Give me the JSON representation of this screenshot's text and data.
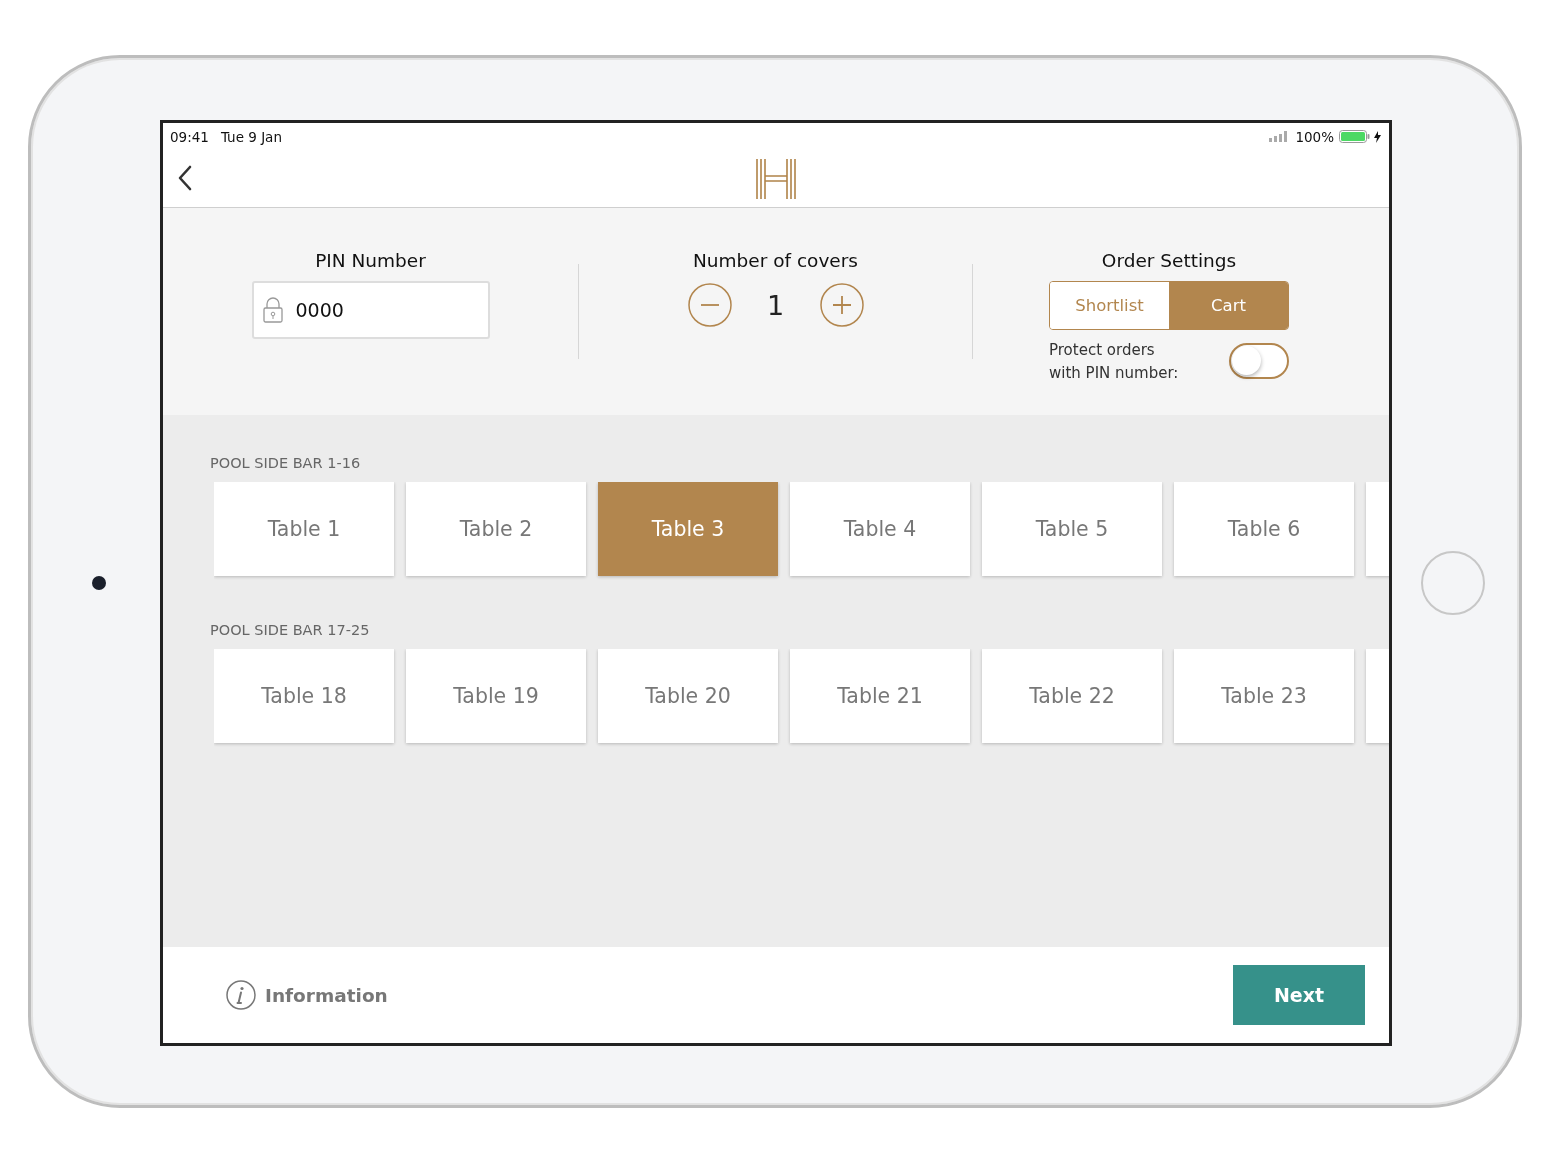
{
  "status_bar": {
    "time": "09:41",
    "date": "Tue 9 Jan",
    "battery": "100%"
  },
  "settings": {
    "pin": {
      "label": "PIN Number",
      "value": "0000"
    },
    "covers": {
      "label": "Number of covers",
      "value": "1"
    },
    "order": {
      "label": "Order Settings",
      "modes": [
        {
          "label": "Shortlist",
          "selected": false
        },
        {
          "label": "Cart",
          "selected": true
        }
      ],
      "protect": {
        "label": "Protect orders with PIN number:",
        "on": false
      }
    }
  },
  "sections": [
    {
      "title": "POOL SIDE BAR 1-16",
      "continues": true,
      "tables": [
        {
          "label": "Table 1",
          "selected": false
        },
        {
          "label": "Table 2",
          "selected": false
        },
        {
          "label": "Table 3",
          "selected": true
        },
        {
          "label": "Table 4",
          "selected": false
        },
        {
          "label": "Table 5",
          "selected": false
        },
        {
          "label": "Table 6",
          "selected": false
        }
      ]
    },
    {
      "title": "POOL SIDE BAR 17-25",
      "continues": true,
      "tables": [
        {
          "label": "Table 18",
          "selected": false
        },
        {
          "label": "Table 19",
          "selected": false
        },
        {
          "label": "Table 20",
          "selected": false
        },
        {
          "label": "Table 21",
          "selected": false
        },
        {
          "label": "Table 22",
          "selected": false
        },
        {
          "label": "Table 23",
          "selected": false
        }
      ]
    }
  ],
  "footer": {
    "info": "Information",
    "next": "Next"
  }
}
